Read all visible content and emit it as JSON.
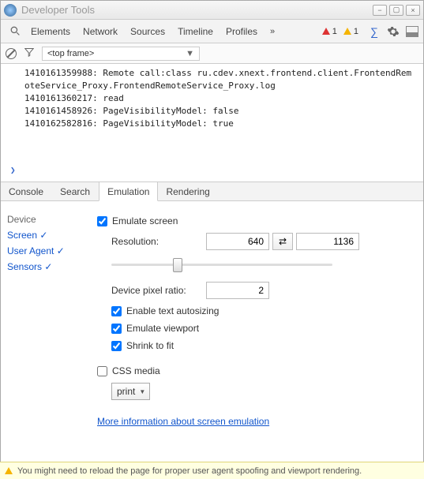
{
  "window": {
    "title": "Developer Tools"
  },
  "mainTabs": [
    "Elements",
    "Network",
    "Sources",
    "Timeline",
    "Profiles"
  ],
  "mainOverflow": "»",
  "badges": {
    "errors": "1",
    "warnings": "1"
  },
  "frameSelect": "<top frame>",
  "console": {
    "lines": [
      "1410161359988: Remote call:class ru.cdev.xnext.frontend.client.FrontendRemoteService_Proxy.FrontendRemoteService_Proxy.log",
      "1410161360217: read",
      "1410161458926: PageVisibilityModel: false",
      "1410162582816: PageVisibilityModel: true"
    ]
  },
  "drawerTabs": [
    "Console",
    "Search",
    "Emulation",
    "Rendering"
  ],
  "drawerActive": 2,
  "emuSide": {
    "device": "Device",
    "items": [
      "Screen ✓",
      "User Agent ✓",
      "Sensors ✓"
    ]
  },
  "emu": {
    "emulateScreen": "Emulate screen",
    "resolutionLabel": "Resolution:",
    "width": "640",
    "height": "1136",
    "ratioLabel": "Device pixel ratio:",
    "ratio": "2",
    "autosize": "Enable text autosizing",
    "viewport": "Emulate viewport",
    "shrink": "Shrink to fit",
    "cssMedia": "CSS media",
    "mediaValue": "print",
    "moreInfo": "More information about screen emulation"
  },
  "status": "You might need to reload the page for proper user agent spoofing and viewport rendering."
}
